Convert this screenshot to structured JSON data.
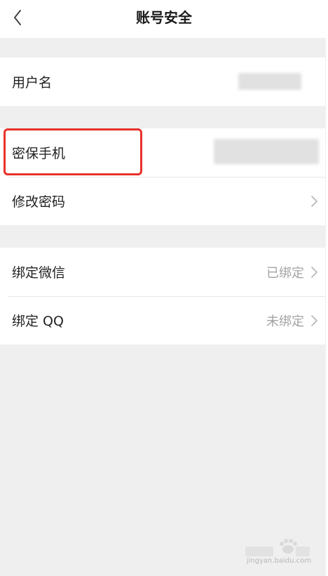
{
  "header": {
    "title": "账号安全",
    "back_icon": "chevron-left-icon"
  },
  "groups": [
    {
      "rows": [
        {
          "label": "用户名"
        }
      ]
    },
    {
      "rows": [
        {
          "label": "密保手机"
        },
        {
          "label": "修改密码",
          "chevron_icon": "chevron-right-icon"
        }
      ]
    },
    {
      "rows": [
        {
          "label": "绑定微信",
          "value": "已绑定",
          "chevron_icon": "chevron-right-icon"
        },
        {
          "label": "绑定 QQ",
          "value": "未绑定",
          "chevron_icon": "chevron-right-icon"
        }
      ]
    }
  ],
  "colors": {
    "background": "#efefef",
    "surface": "#ffffff",
    "highlight": "#e8312a",
    "secondary_text": "#a3a3a3"
  },
  "watermark": {
    "logo": "baidu-jingyan-logo",
    "text": "jingyan.baidu.com"
  }
}
